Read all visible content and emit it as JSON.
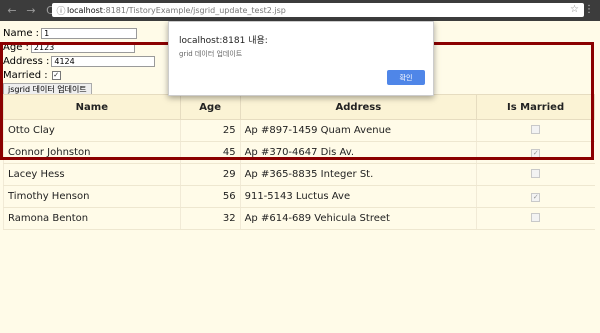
{
  "browser": {
    "url_host": "localhost",
    "url_path": ":8181/TistoryExample/jsgrid_update_test2.jsp",
    "back": "←",
    "forward": "→",
    "reload": "C",
    "info": "ⓘ",
    "star": "☆",
    "menu": "⋮"
  },
  "form": {
    "name_label": "Name :",
    "name_value": "1",
    "age_label": "Age :",
    "age_value": "2123",
    "address_label": "Address :",
    "address_value": "4124",
    "married_label": "Married :",
    "married_checked": "✓",
    "update_button": "jsgrid 데이터 업데이트"
  },
  "grid": {
    "headers": [
      "Name",
      "Age",
      "Address",
      "Is Married"
    ],
    "rows": [
      {
        "name": "Otto Clay",
        "age": "25",
        "address": "Ap #897-1459 Quam Avenue",
        "married": ""
      },
      {
        "name": "Connor Johnston",
        "age": "45",
        "address": "Ap #370-4647 Dis Av.",
        "married": "✓"
      },
      {
        "name": "Lacey Hess",
        "age": "29",
        "address": "Ap #365-8835 Integer St.",
        "married": ""
      },
      {
        "name": "Timothy Henson",
        "age": "56",
        "address": "911-5143 Luctus Ave",
        "married": "✓"
      },
      {
        "name": "Ramona Benton",
        "age": "32",
        "address": "Ap #614-689 Vehicula Street",
        "married": ""
      }
    ]
  },
  "dialog": {
    "title": "localhost:8181 내용:",
    "message": "grid 데이터 업데이트",
    "ok": "확인"
  }
}
